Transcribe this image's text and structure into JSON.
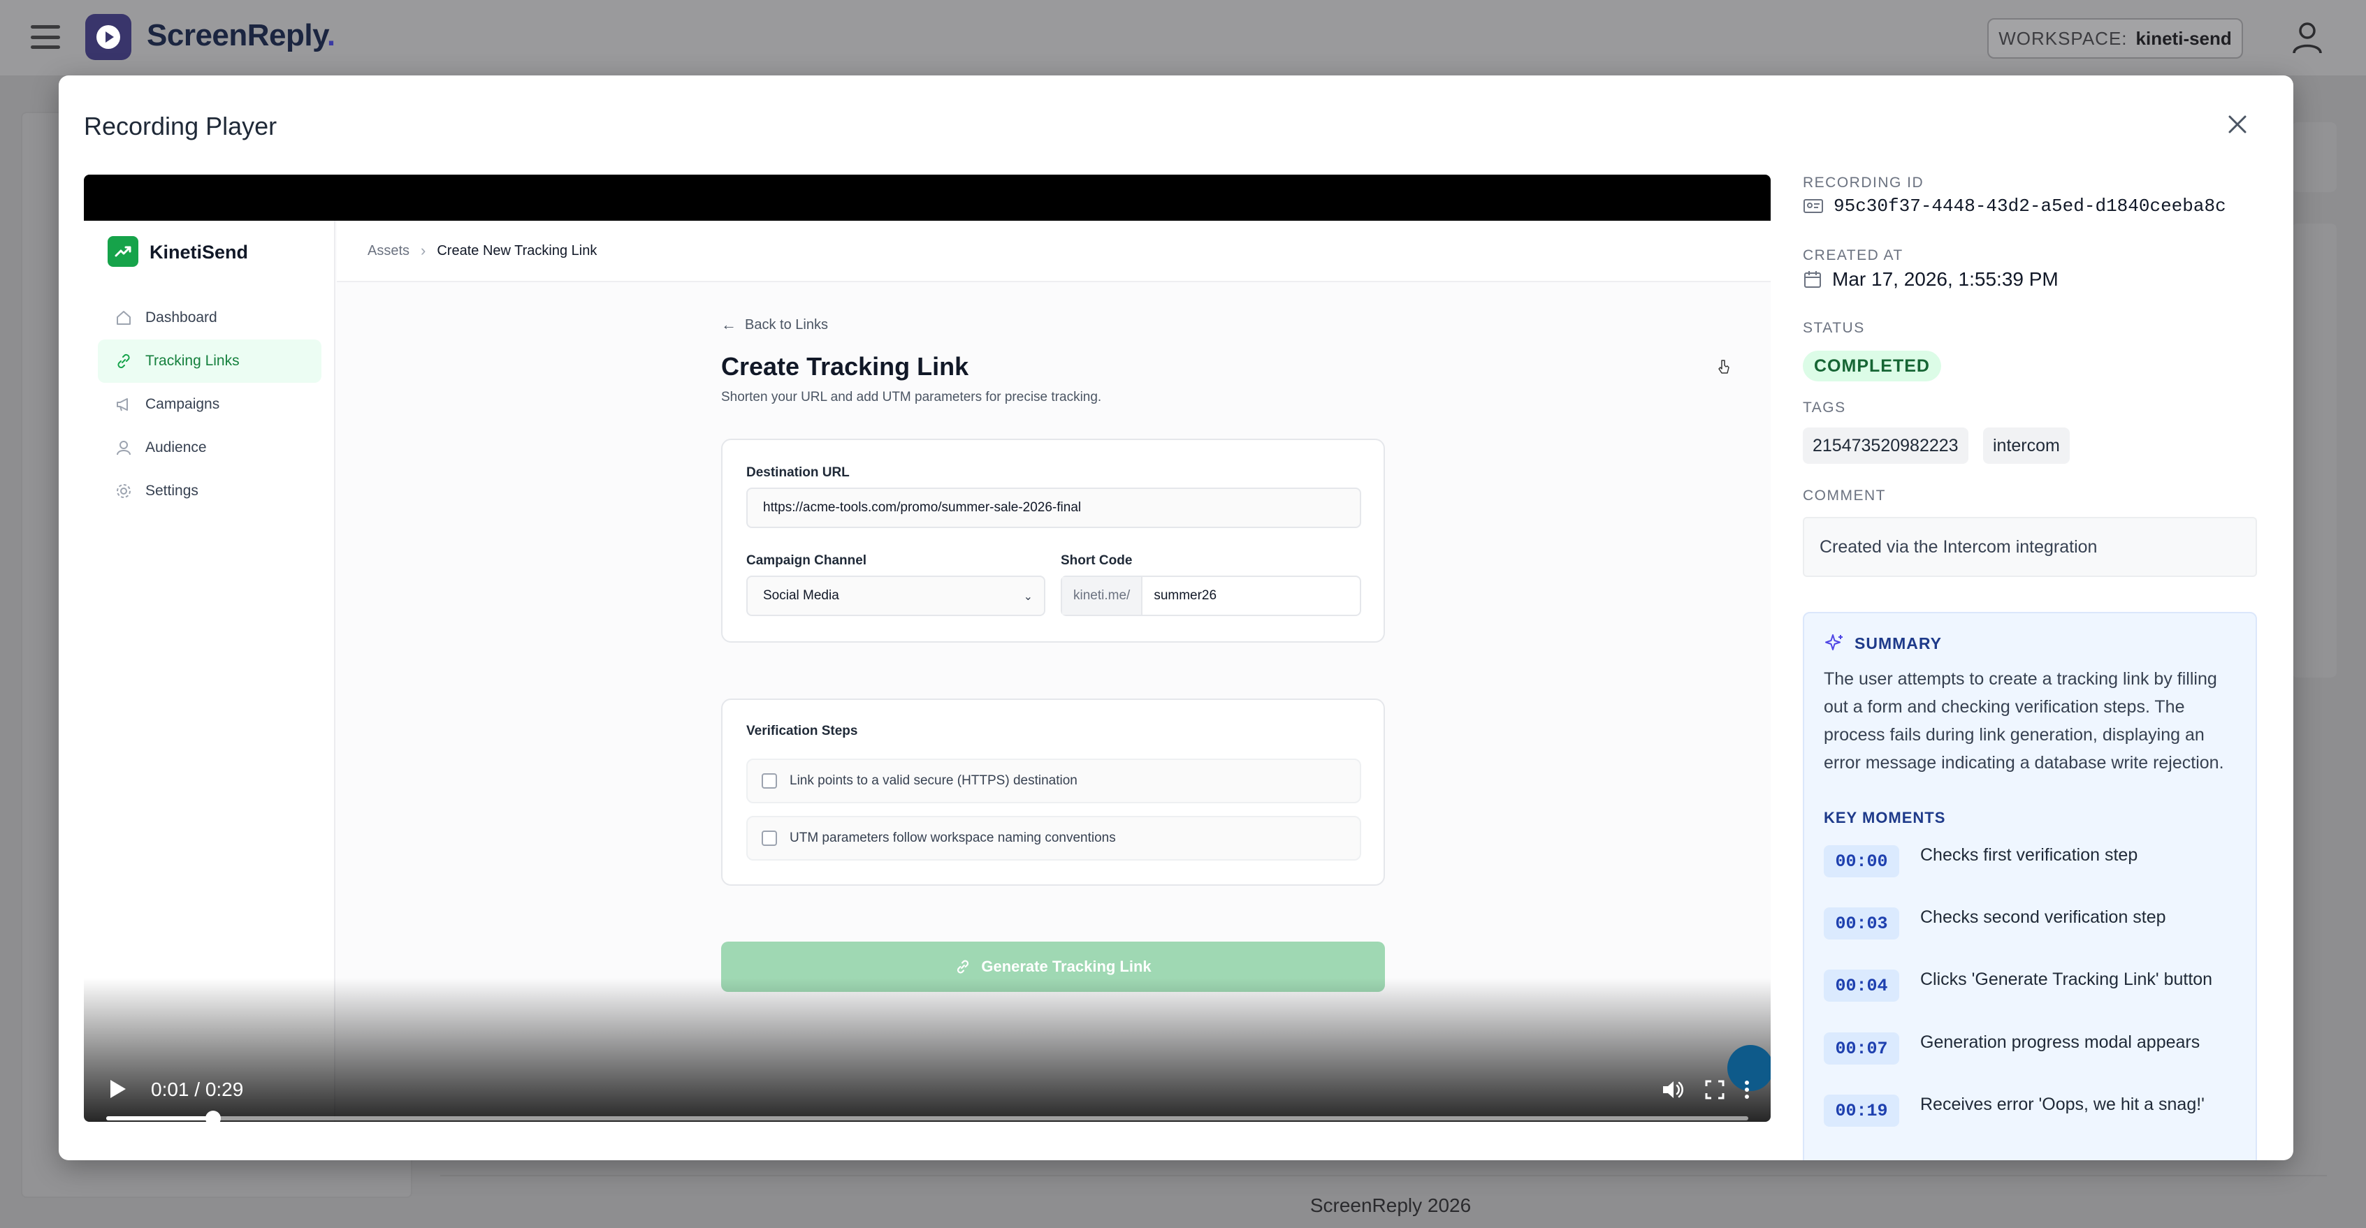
{
  "app": {
    "brand": "ScreenReply",
    "brand_dot": ".",
    "workspace_label": "WORKSPACE:",
    "workspace_value": "kineti-send",
    "footer": "ScreenReply 2026"
  },
  "modal": {
    "title": "Recording Player"
  },
  "recording": {
    "app_name": "KinetiSend",
    "nav": [
      {
        "label": "Dashboard",
        "icon": "home-icon"
      },
      {
        "label": "Tracking Links",
        "icon": "link-icon",
        "active": true
      },
      {
        "label": "Campaigns",
        "icon": "megaphone-icon"
      },
      {
        "label": "Audience",
        "icon": "user-icon"
      },
      {
        "label": "Settings",
        "icon": "gear-icon"
      }
    ],
    "breadcrumb": [
      "Assets",
      "Create New Tracking Link"
    ],
    "back_link": "Back to Links",
    "form_title": "Create Tracking Link",
    "form_subtitle": "Shorten your URL and add UTM parameters for precise tracking.",
    "destination_label": "Destination URL",
    "destination_value": "https://acme-tools.com/promo/summer-sale-2026-final",
    "channel_label": "Campaign Channel",
    "channel_value": "Social Media",
    "shortcode_label": "Short Code",
    "shortcode_prefix": "kineti.me/",
    "shortcode_value": "summer26",
    "verification_title": "Verification Steps",
    "checks": [
      "Link points to a valid secure (HTTPS) destination",
      "UTM parameters follow workspace naming conventions"
    ],
    "generate_label": "Generate Tracking Link"
  },
  "player": {
    "time": "0:01 / 0:29",
    "progress": 0.065
  },
  "details": {
    "recording_id_label": "RECORDING ID",
    "recording_id": "95c30f37-4448-43d2-a5ed-d1840ceeba8c",
    "created_label": "CREATED AT",
    "created": "Mar 17, 2026, 1:55:39 PM",
    "status_label": "STATUS",
    "status": "COMPLETED",
    "status_color": "#166534",
    "tags_label": "TAGS",
    "tags": [
      "215473520982223",
      "intercom"
    ],
    "comment_label": "COMMENT",
    "comment": "Created via the Intercom integration",
    "summary_label": "SUMMARY",
    "summary": "The user attempts to create a tracking link by filling out a form and checking verification steps. The process fails during link generation, displaying an error message indicating a database write rejection.",
    "key_moments_label": "KEY MOMENTS",
    "key_moments": [
      {
        "time": "00:00",
        "text": "Checks first verification step"
      },
      {
        "time": "00:03",
        "text": "Checks second verification step"
      },
      {
        "time": "00:04",
        "text": "Clicks 'Generate Tracking Link' button"
      },
      {
        "time": "00:07",
        "text": "Generation progress modal appears"
      },
      {
        "time": "00:19",
        "text": "Receives error 'Oops, we hit a snag!'"
      }
    ]
  },
  "colors": {
    "brand": "#39356b",
    "accent_green": "#16a34a",
    "summary_accent": "#1e3a8a"
  }
}
